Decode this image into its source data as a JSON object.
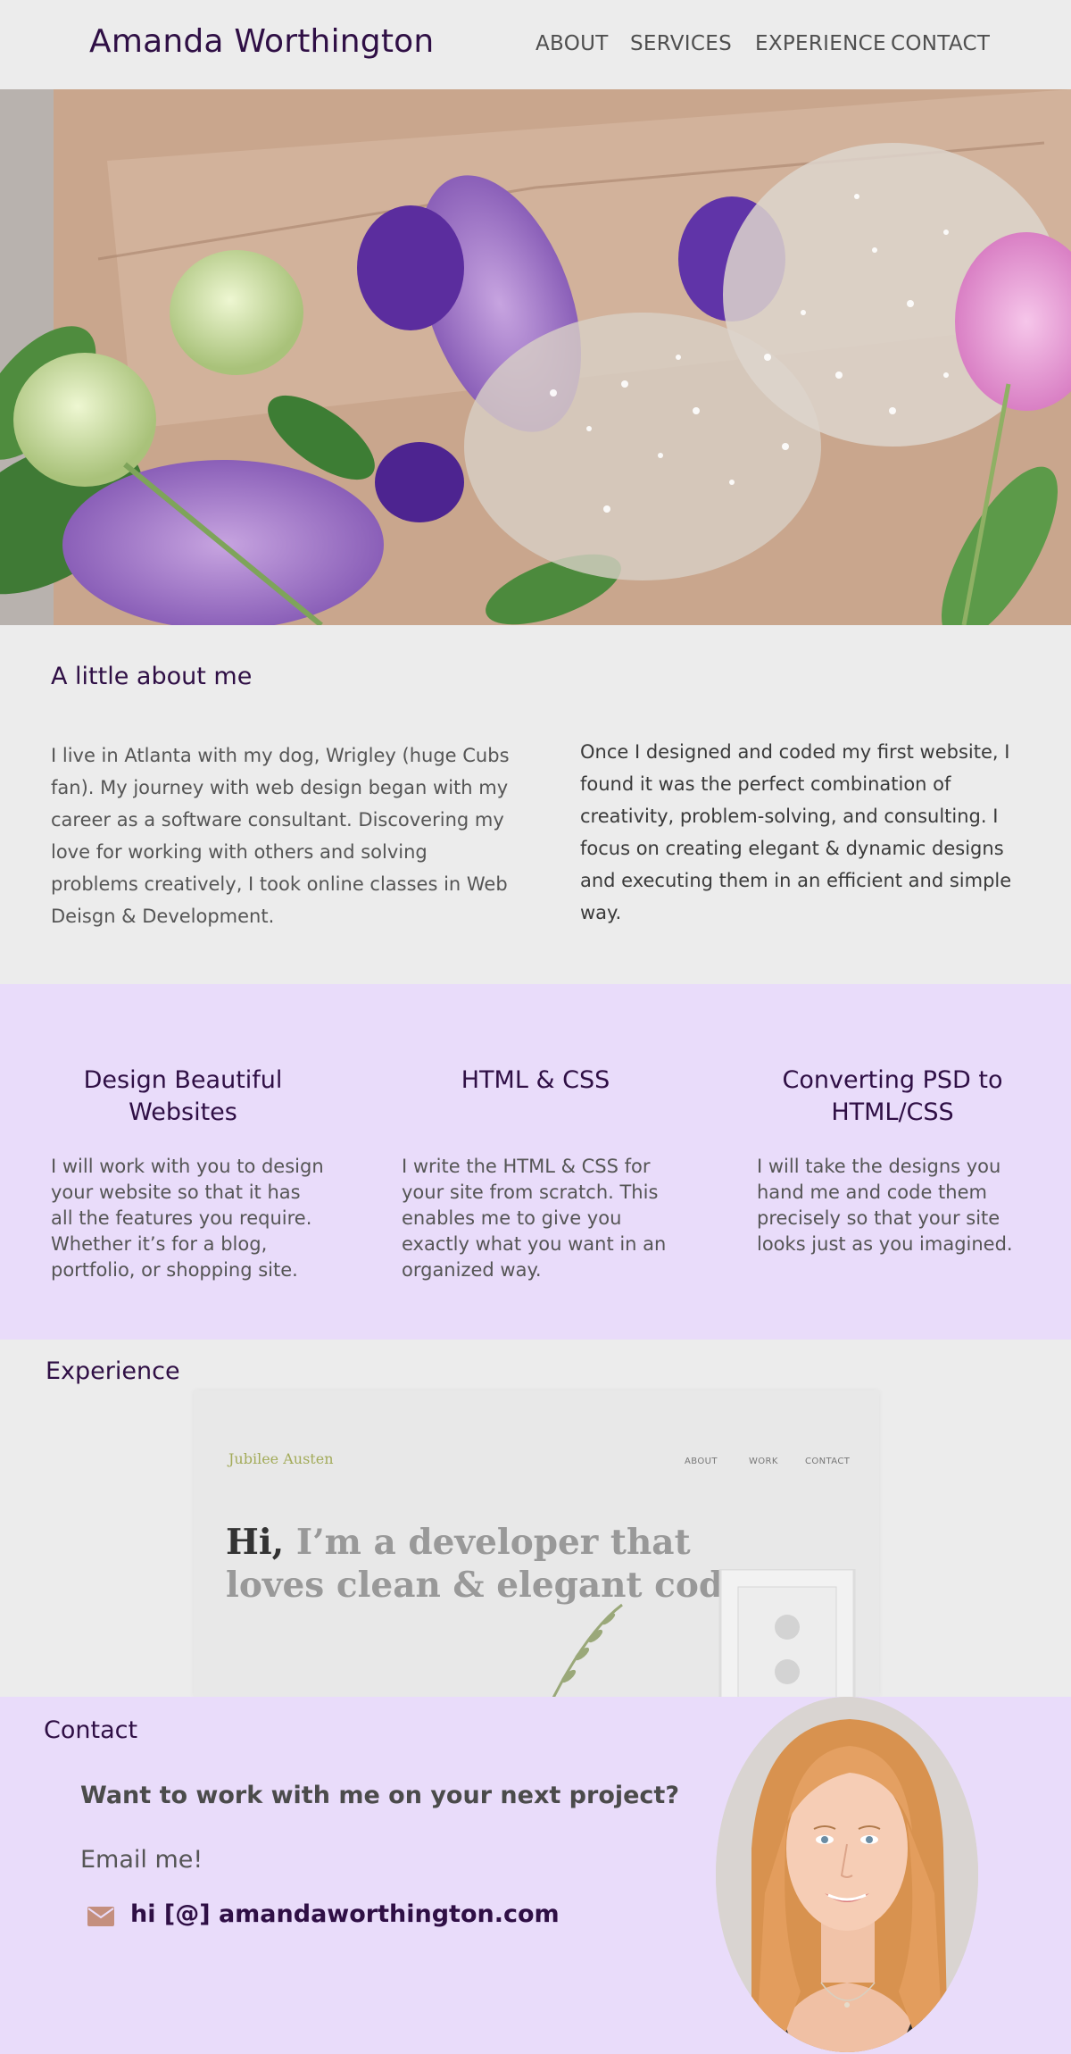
{
  "header": {
    "brand": "Amanda Worthington",
    "nav": [
      "ABOUT",
      "SERVICES",
      "EXPERIENCE",
      "CONTACT"
    ]
  },
  "hero": {
    "image": "flowers-lilac-hydrangea-babys-breath"
  },
  "about": {
    "title": "A little about me",
    "paragraph1": "I live in Atlanta with my dog, Wrigley (huge Cubs fan). My journey with web design began with my career as a software consultant. Discovering my love for working with others and solving problems creatively, I took online classes in Web Deisgn & Development.",
    "paragraph2": "Once I designed and coded my first website, I found it was the perfect combination of creativity, problem-solving, and  consulting. I focus on creating elegant & dynamic designs and executing them in an efficient and simple way."
  },
  "services": [
    {
      "title": "Design Beautiful Websites",
      "text": "I will work with you to design your website so that it has all the features you require. Whether it’s for a blog, portfolio, or shopping site."
    },
    {
      "title": "HTML & CSS",
      "text": "I write the HTML & CSS for your site from scratch. This enables me to give you exactly what you want in an organized way."
    },
    {
      "title": "Converting PSD to HTML/CSS",
      "text": "I will take the designs you hand me and code them precisely so that your site looks just as you imagined."
    }
  ],
  "experience": {
    "title": "Experience",
    "mock": {
      "brand": "Jubilee Austen",
      "nav": [
        "ABOUT",
        "WORK",
        "CONTACT"
      ],
      "hero_hi": "Hi,",
      "hero_rest": "I’m a developer that loves clean & elegant code."
    }
  },
  "contact": {
    "title": "Contact",
    "question": "Want to work with me on your next project?",
    "email_label": "Email me!",
    "email": "hi [@] amandaworthington.com",
    "icon": "envelope-icon"
  },
  "colors": {
    "accent": "#2f0f45",
    "lavender": "#e9dcfa",
    "background": "#ececec",
    "envelope": "#c48f7e"
  }
}
